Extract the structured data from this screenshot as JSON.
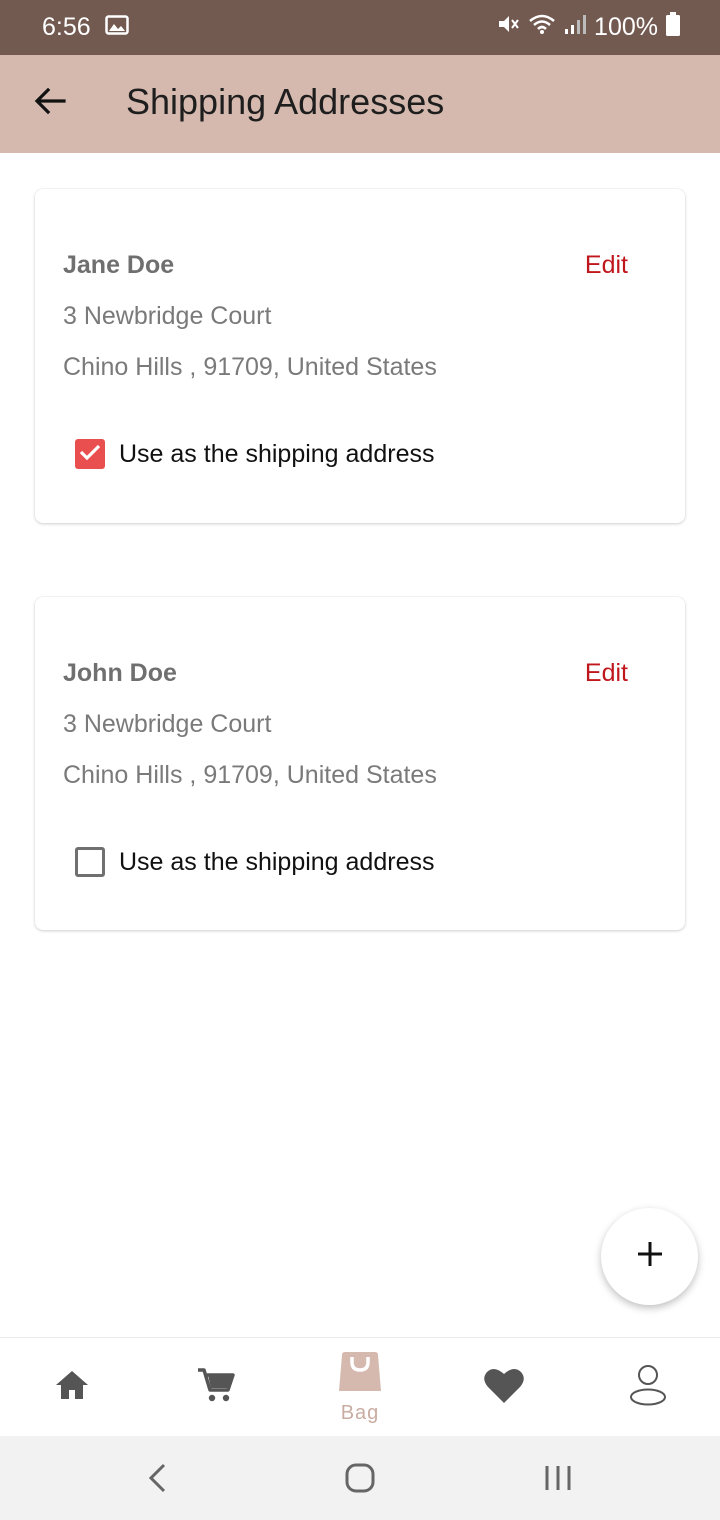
{
  "status_bar": {
    "time": "6:56",
    "battery": "100%",
    "icons": [
      "image-icon",
      "mute-icon",
      "wifi-icon",
      "signal-icon",
      "battery-icon"
    ]
  },
  "app_bar": {
    "title": "Shipping Addresses",
    "back_icon": "arrow-left-icon"
  },
  "addresses": [
    {
      "name": "Jane Doe",
      "edit_label": "Edit",
      "line1": "3 Newbridge Court",
      "line2": "Chino Hills , 91709, United States",
      "checkbox_label": "Use as the shipping address",
      "checked": true
    },
    {
      "name": "John Doe",
      "edit_label": "Edit",
      "line1": "3 Newbridge Court",
      "line2": "Chino Hills , 91709, United States",
      "checkbox_label": "Use as the shipping address",
      "checked": false
    }
  ],
  "fab": {
    "icon": "plus-icon"
  },
  "bottom_nav": {
    "items": [
      {
        "icon": "home-icon",
        "label": ""
      },
      {
        "icon": "cart-icon",
        "label": ""
      },
      {
        "icon": "bag-icon",
        "label": "Bag",
        "active": true
      },
      {
        "icon": "heart-icon",
        "label": ""
      },
      {
        "icon": "profile-icon",
        "label": ""
      }
    ]
  },
  "colors": {
    "status_bar": "#735a51",
    "app_bar": "#d5b9ae",
    "accent_edit": "#c0171d",
    "checkbox_checked": "#ea4f4f",
    "nav_active": "#c9aca2"
  }
}
